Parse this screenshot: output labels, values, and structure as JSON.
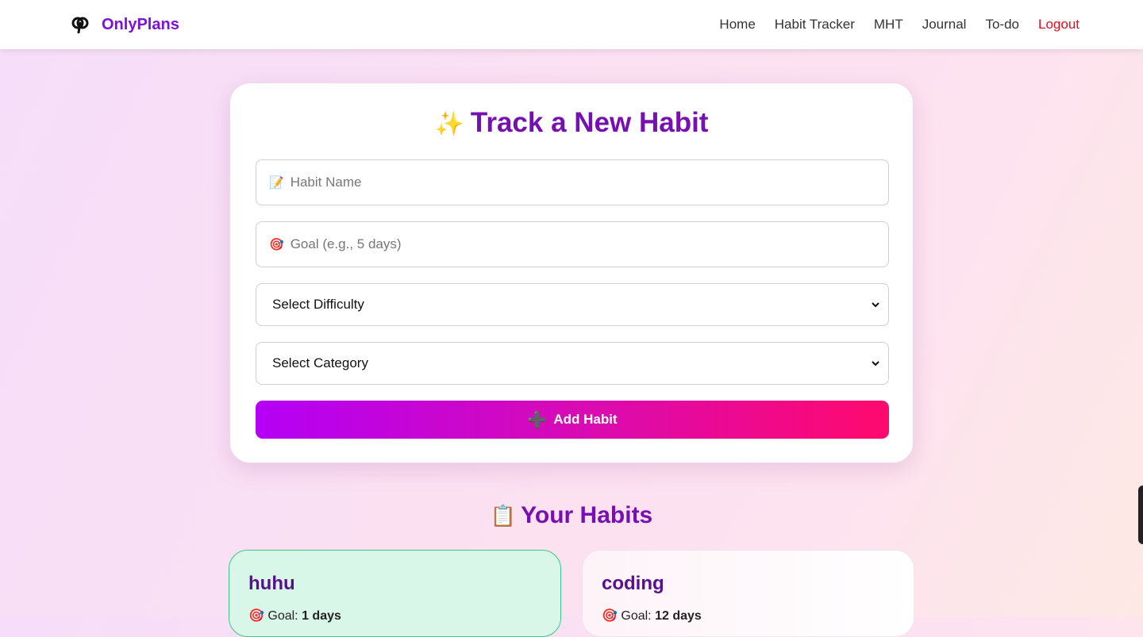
{
  "nav": {
    "brand": "OnlyPlans",
    "links": [
      "Home",
      "Habit Tracker",
      "MHT",
      "Journal",
      "To-do",
      "Logout"
    ]
  },
  "form": {
    "title_emoji": "✨",
    "title": "Track a New Habit",
    "habit_name_placeholder": "Habit Name",
    "habit_name_icon": "📝",
    "goal_placeholder": "Goal (e.g., 5 days)",
    "goal_icon": "🎯",
    "difficulty_selected": "Select Difficulty",
    "category_selected": "Select Category",
    "add_button": "Add Habit",
    "add_button_icon": "➕"
  },
  "habits_section": {
    "emoji": "📋",
    "title": "Your Habits",
    "goal_label": "Goal:",
    "goal_icon": "🎯",
    "items": [
      {
        "name": "huhu",
        "goal": "1 days"
      },
      {
        "name": "coding",
        "goal": "12 days"
      }
    ]
  },
  "colors": {
    "brand": "#7a12d8",
    "title": "#7710b0",
    "logout": "#e60d1f",
    "button_gradient_start": "#b400f5",
    "button_gradient_end": "#ff0a6d"
  }
}
